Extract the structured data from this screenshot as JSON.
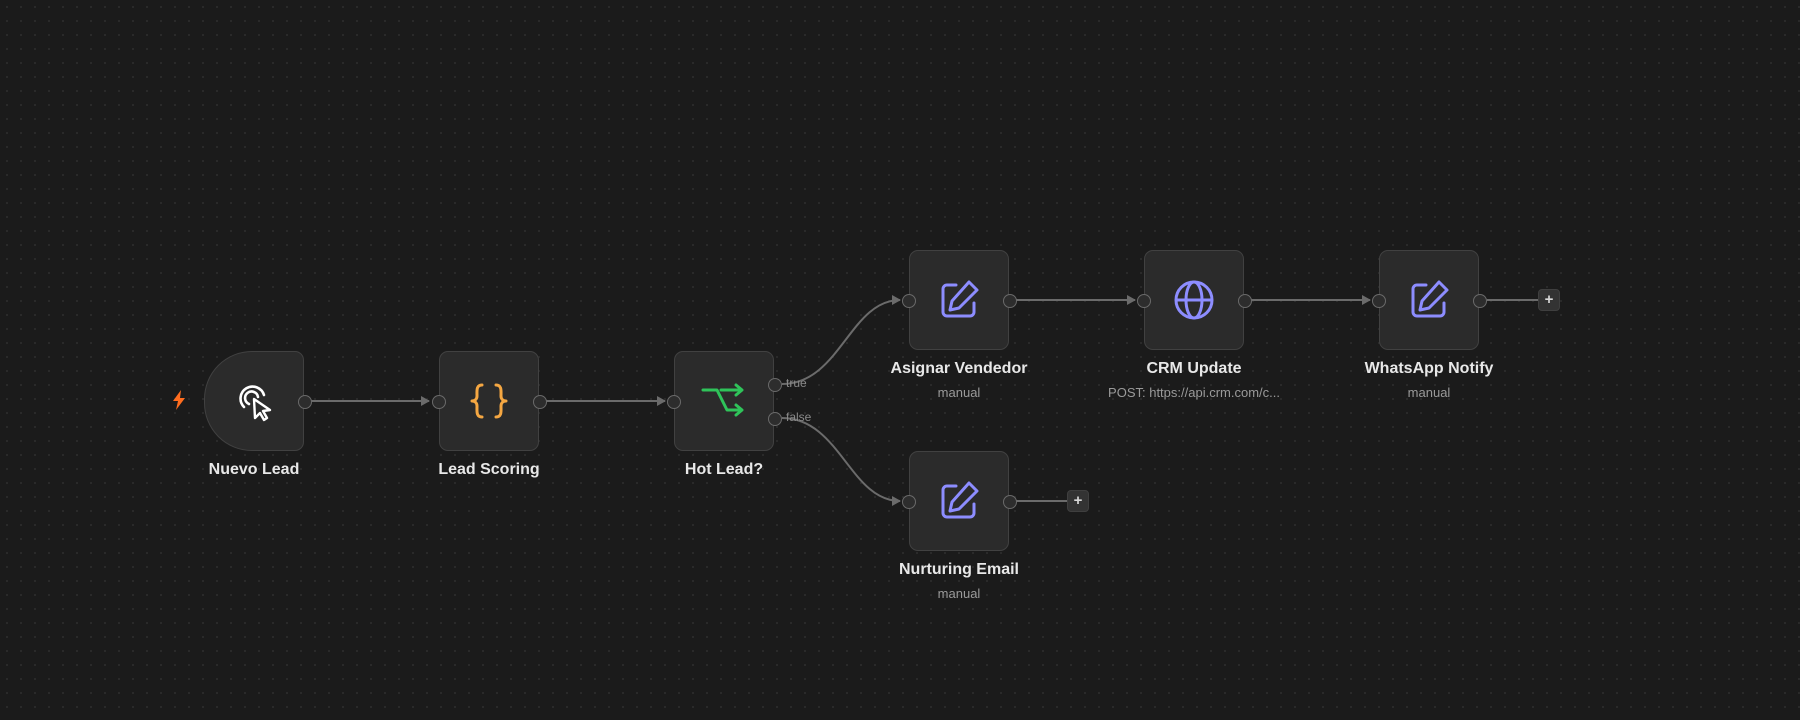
{
  "colors": {
    "background": "#1b1b1b",
    "node_fill": "#2b2b2b",
    "edge": "#6b6b6b",
    "trigger_icon": "#ffffff",
    "code_icon": "#f5a742",
    "branch_icon": "#2fc35a",
    "action_icon": "#8d8dff",
    "bolt": "#ff6d1f"
  },
  "nodes": {
    "nuevo_lead": {
      "label": "Nuevo Lead",
      "icon": "pointer-click-icon"
    },
    "lead_scoring": {
      "label": "Lead Scoring",
      "icon": "braces-icon"
    },
    "hot_lead": {
      "label": "Hot Lead?",
      "icon": "branch-icon",
      "outputs": [
        "true",
        "false"
      ]
    },
    "asignar_vendedor": {
      "label": "Asignar Vendedor",
      "sublabel": "manual",
      "icon": "edit-icon"
    },
    "crm_update": {
      "label": "CRM Update",
      "sublabel": "POST: https://api.crm.com/c...",
      "icon": "globe-icon"
    },
    "whatsapp_notify": {
      "label": "WhatsApp Notify",
      "sublabel": "manual",
      "icon": "edit-icon"
    },
    "nurturing_email": {
      "label": "Nurturing Email",
      "sublabel": "manual",
      "icon": "edit-icon"
    }
  },
  "add_button": {
    "label": "+"
  },
  "trigger_marker": {
    "icon": "lightning-bolt-icon"
  }
}
